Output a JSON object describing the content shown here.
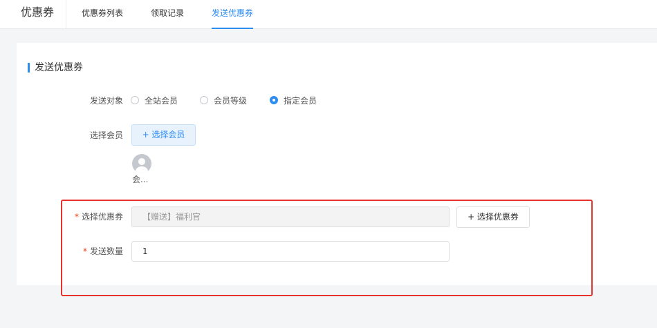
{
  "header": {
    "brand": "优惠券",
    "tabs": [
      {
        "label": "优惠券列表"
      },
      {
        "label": "领取记录"
      },
      {
        "label": "发送优惠券"
      }
    ]
  },
  "section": {
    "title": "发送优惠券"
  },
  "form": {
    "target": {
      "label": "发送对象",
      "options": [
        "全站会员",
        "会员等级",
        "指定会员"
      ],
      "selected": "指定会员"
    },
    "member": {
      "label": "选择会员",
      "button": "+ 选择会员",
      "selected_name": "会..."
    },
    "coupon": {
      "required_mark": "*",
      "label": "选择优惠券",
      "value": "【赠送】福利官",
      "button": "+ 选择优惠券"
    },
    "quantity": {
      "required_mark": "*",
      "label": "发送数量",
      "value": "1"
    }
  },
  "colors": {
    "accent": "#2d8cf0",
    "highlight_border": "#e8322d",
    "required": "#ed4014"
  }
}
